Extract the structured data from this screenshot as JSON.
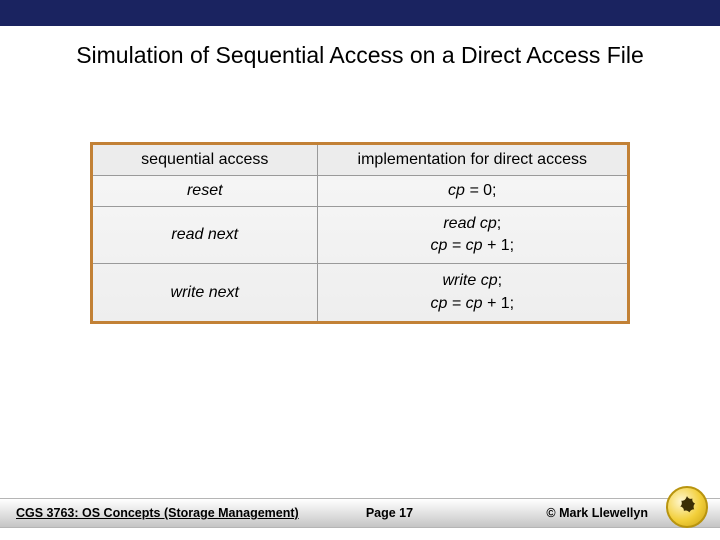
{
  "title": "Simulation of Sequential Access on a Direct Access File",
  "table": {
    "headers": {
      "left": "sequential access",
      "right": "implementation for direct access"
    },
    "rows": [
      {
        "left": "reset",
        "right": "cp = 0;"
      },
      {
        "left": "read next",
        "right": "read cp;\ncp = cp + 1;"
      },
      {
        "left": "write next",
        "right": "write cp;\ncp = cp + 1;"
      }
    ]
  },
  "footer": {
    "course": "CGS 3763: OS Concepts (Storage Management)",
    "page": "Page 17",
    "author": "© Mark Llewellyn"
  }
}
